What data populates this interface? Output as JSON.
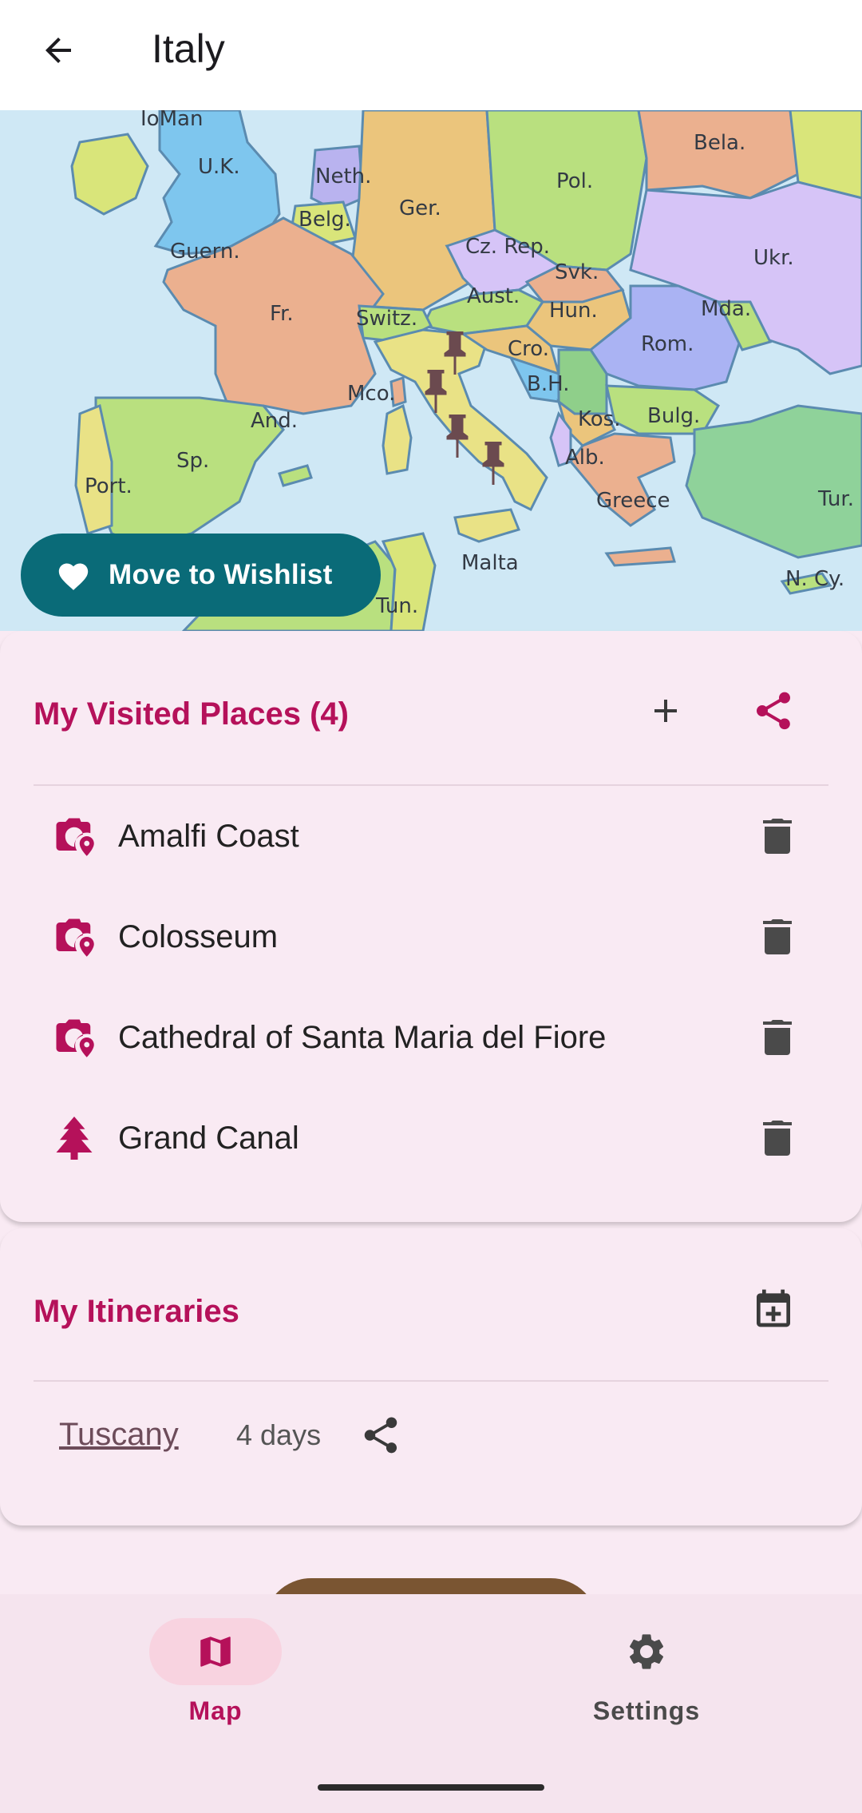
{
  "appbar": {
    "title": "Italy"
  },
  "map": {
    "labels": {
      "ioman": "IoMan",
      "uk": "U.K.",
      "neth": "Neth.",
      "ger": "Ger.",
      "pol": "Pol.",
      "bela": "Bela.",
      "belg": "Belg.",
      "guern": "Guern.",
      "czrep": "Cz. Rep.",
      "svk": "Svk.",
      "ukr": "Ukr.",
      "aust": "Aust.",
      "hun": "Hun.",
      "mda": "Mda.",
      "fr": "Fr.",
      "switz": "Switz.",
      "rom": "Rom.",
      "cro": "Cro.",
      "bh": "B.H.",
      "mco": "Mco.",
      "kos": "Kos.",
      "bulg": "Bulg.",
      "and": "And.",
      "sp": "Sp.",
      "alb": "Alb.",
      "port": "Port.",
      "greece": "Greece",
      "tur": "Tur.",
      "malta": "Malta",
      "ncy": "N. Cy.",
      "tun": "Tun."
    },
    "wishlist_button": "Move to Wishlist"
  },
  "visited": {
    "title": "My Visited Places (4)",
    "places": [
      {
        "name": "Amalfi Coast",
        "icon": "camera-pin-icon"
      },
      {
        "name": "Colosseum",
        "icon": "camera-pin-icon"
      },
      {
        "name": "Cathedral of Santa Maria del Fiore",
        "icon": "camera-pin-icon"
      },
      {
        "name": "Grand Canal",
        "icon": "tree-icon"
      }
    ]
  },
  "itineraries": {
    "title": "My Itineraries",
    "items": [
      {
        "name": "Tuscany",
        "days": "4 days"
      }
    ]
  },
  "nav": {
    "map": "Map",
    "settings": "Settings"
  },
  "colors": {
    "accent": "#b5115a",
    "teal": "#0a6b78",
    "pin": "#6b4a4f"
  }
}
